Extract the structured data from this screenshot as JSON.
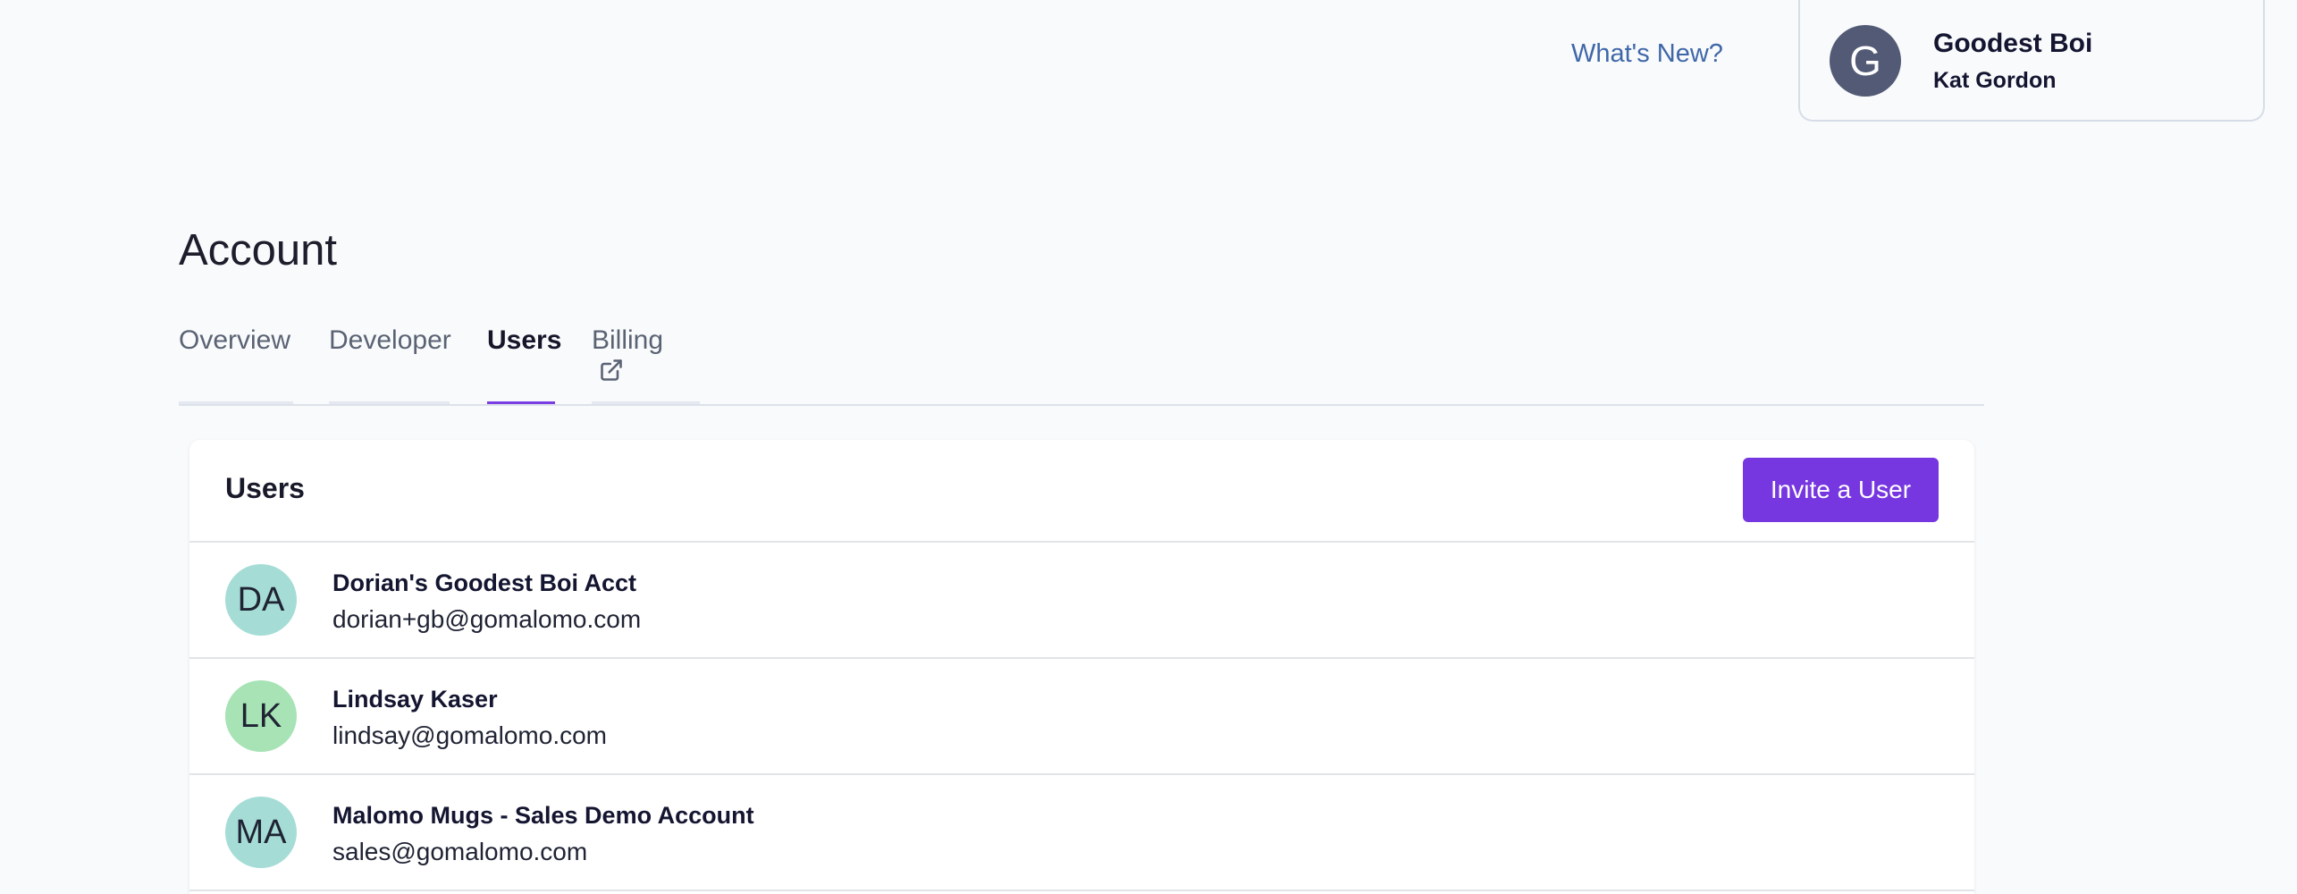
{
  "header": {
    "whats_new": "What's New?",
    "account": {
      "avatar_initial": "G",
      "org_name": "Goodest Boi",
      "user_name": "Kat Gordon"
    }
  },
  "page": {
    "title": "Account"
  },
  "tabs": [
    {
      "label": "Overview",
      "active": false
    },
    {
      "label": "Developer",
      "active": false
    },
    {
      "label": "Users",
      "active": true
    },
    {
      "label": "Billing",
      "active": false,
      "icon": "external-link-icon"
    }
  ],
  "users_card": {
    "title": "Users",
    "invite_label": "Invite a User",
    "users": [
      {
        "initials": "DA",
        "name": "Dorian's Goodest Boi Acct",
        "email": "dorian+gb@gomalomo.com",
        "color": "#a5ddd6"
      },
      {
        "initials": "LK",
        "name": "Lindsay Kaser",
        "email": "lindsay@gomalomo.com",
        "color": "#a7e3b5"
      },
      {
        "initials": "MA",
        "name": "Malomo Mugs - Sales Demo Account",
        "email": "sales@gomalomo.com",
        "color": "#a5ddd6"
      }
    ]
  },
  "colors": {
    "accent": "#7636e0",
    "link": "#3f67a8",
    "account_avatar": "#525a75"
  }
}
